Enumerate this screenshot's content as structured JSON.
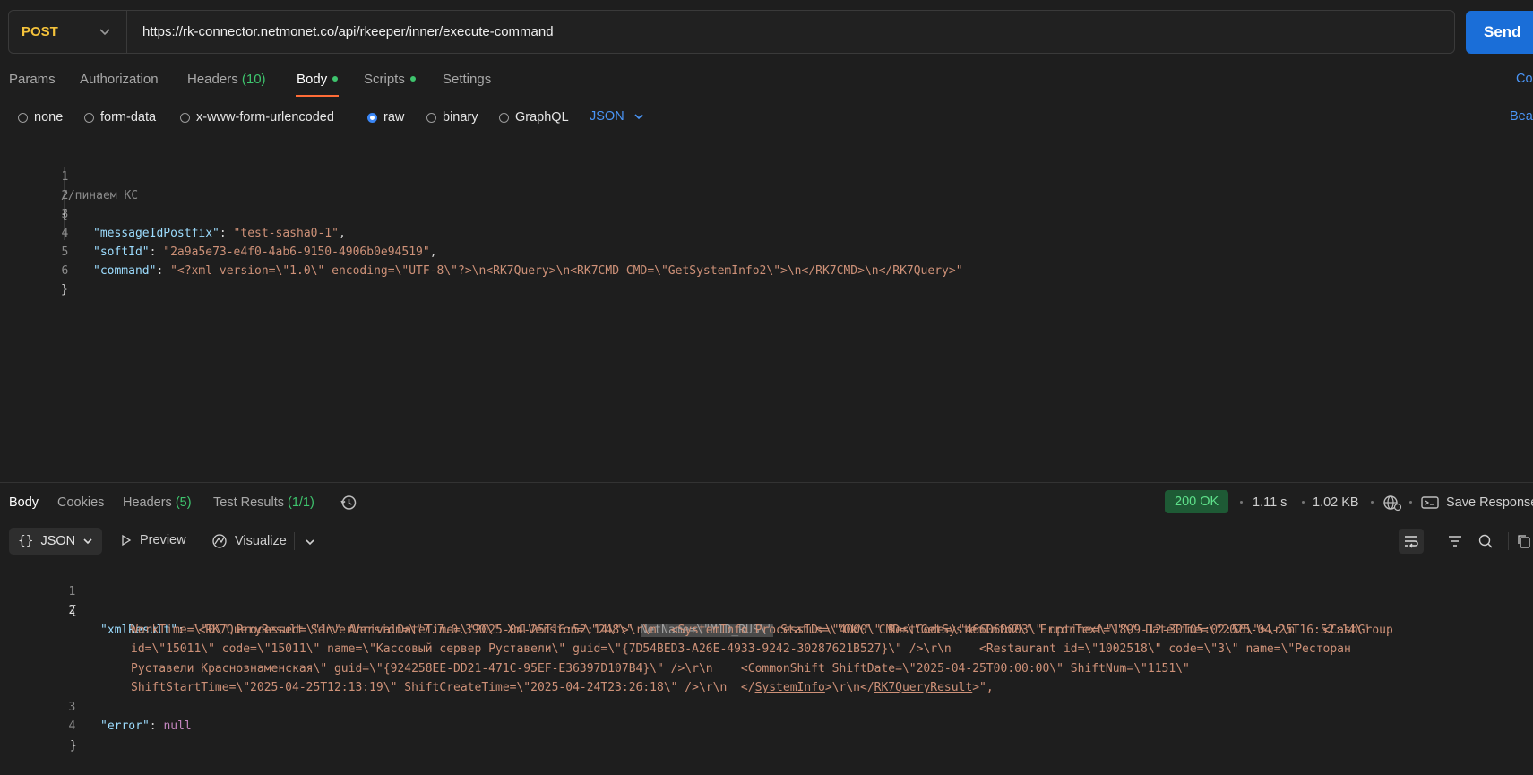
{
  "request": {
    "method": "POST",
    "url": "https://rk-connector.netmonet.co/api/rkeeper/inner/execute-command",
    "send_label": "Send"
  },
  "request_tabs": {
    "params": "Params",
    "authorization": "Authorization",
    "headers_label": "Headers",
    "headers_count": "(10)",
    "body": "Body",
    "scripts": "Scripts",
    "settings": "Settings",
    "cookies_partial": "Co"
  },
  "body_types": {
    "none": "none",
    "form_data": "form-data",
    "urlencoded": "x-www-form-urlencoded",
    "raw": "raw",
    "binary": "binary",
    "graphql": "GraphQL",
    "language": "JSON",
    "beautify_partial": "Bea"
  },
  "request_body": {
    "line_numbers": [
      "1",
      "2",
      "3",
      "4",
      "5",
      "6"
    ],
    "comment": "//пинаем КС",
    "open_brace": "{",
    "close_brace": "}",
    "fields": [
      {
        "key": "\"messageIdPostfix\"",
        "value": "\"test-sasha0-1\"",
        "trail": ","
      },
      {
        "key": "\"softId\"",
        "value": "\"2a9a5e73-e4f0-4ab6-9150-4906b0e94519\"",
        "trail": ","
      },
      {
        "key": "\"command\"",
        "value": "\"<?xml version=\\\"1.0\\\" encoding=\\\"UTF-8\\\"?>\\n<RK7Query>\\n<RK7CMD CMD=\\\"GetSystemInfo2\\\">\\n</RK7CMD>\\n</RK7Query>\"",
        "trail": ""
      }
    ]
  },
  "response_tabs": {
    "body": "Body",
    "cookies": "Cookies",
    "headers_label": "Headers",
    "headers_count": "(5)",
    "test_results_label": "Test Results",
    "test_results_count": "(1/1)"
  },
  "response_meta": {
    "status": "200 OK",
    "time": "1.11 s",
    "size": "1.02 KB",
    "save_label": "Save Response"
  },
  "response_toolbar": {
    "format": "JSON",
    "preview": "Preview",
    "visualize": "Visualize"
  },
  "response_body": {
    "line_numbers": [
      "1",
      "2",
      "3",
      "4"
    ],
    "open_brace": "{",
    "close_brace": "}",
    "xml_key": "\"xmlResult\"",
    "xml_lines": [
      {
        "before": "\"<RK7QueryResult ServerVersion=\\\"7.7.0.390\\\" XmlVersion=\\\"248\\\" ",
        "highlight": "NetName=\\\"MID_RUS\\\"",
        "after": " Status=\\\"Ok\\\" CMD=\\\"GetSystemInfo2\\\" ErrorText=\\\"\\\" DateTime=\\\"2025-04-25T16:52:14\\\""
      },
      {
        "text": "WorkTime=\\\"0\\\" Processed=\\\"1\\\" ArrivalDateTime=\\\"2025-04-25T16:52:14\\\">\\r\\n  <SystemInfo ProcessID=\\\"4000\\\" RestCode=\\\"466060003\\\" uptime=\\\"1899-12-30T05:02:56\\\">\\r\\n    <CashGroup"
      },
      {
        "text": "id=\\\"15011\\\" code=\\\"15011\\\" name=\\\"Кассовый сервер Руставели\\\" guid=\\\"{7D54BED3-A26E-4933-9242-30287621B527}\\\" />\\r\\n    <Restaurant id=\\\"1002518\\\" code=\\\"3\\\" name=\\\"Ресторан"
      },
      {
        "text": "Руставели Краснознаменская\\\" guid=\\\"{924258EE-DD21-471C-95EF-E36397D107B4}\\\" />\\r\\n    <CommonShift ShiftDate=\\\"2025-04-25T00:00:00\\\" ShiftNum=\\\"1151\\\""
      },
      {
        "before": "ShiftStartTime=\\\"2025-04-25T12:13:19\\\" ShiftCreateTime=\\\"2025-04-24T23:26:18\\\" />\\r\\n  </",
        "u1": "SystemInfo",
        "mid": ">\\r\\n</",
        "u2": "RK7QueryResult",
        "after": ">\","
      }
    ],
    "error_key": "\"error\"",
    "error_value": "null"
  },
  "colors": {
    "accent_send": "#1a6ed8",
    "method": "#f5c33b",
    "status_ok": "#5ee08a",
    "tab_underline": "#ff6c37",
    "json_key": "#9cdcfe",
    "json_string": "#ce9178"
  }
}
